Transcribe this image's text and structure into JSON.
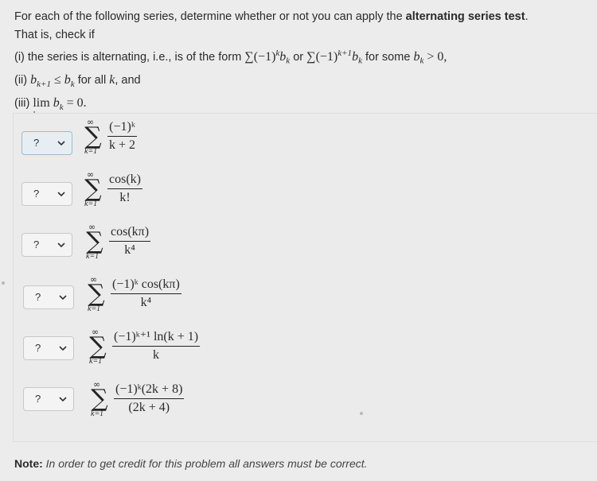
{
  "intro": {
    "line1_a": "For each of the following series, determine whether or not you can apply the",
    "line1_b": "alternating series test",
    "line1_c": ".",
    "line2": "That is, check if",
    "cond1_a": "(i) the series is alternating, i.e., is of the form",
    "cond1_f1": "∑(−1)",
    "cond1_e1": "k",
    "cond1_b1": "b",
    "cond1_s1": "k",
    "cond1_or": "or",
    "cond1_f2": "∑(−1)",
    "cond1_e2": "k+1",
    "cond1_b2": "b",
    "cond1_s2": "k",
    "cond1_c": "for some",
    "cond1_d": "b",
    "cond1_d_sub": "k",
    "cond1_gt": "> 0,",
    "cond2_a": "(ii)",
    "cond2_m": "b",
    "cond2_m_sub": "k+1",
    "cond2_le": "≤",
    "cond2_m2": "b",
    "cond2_m2_sub": "k",
    "cond2_b": "for all",
    "cond2_k": "k",
    "cond2_c": ", and",
    "cond3_a": "(iii)",
    "cond3_lim": "lim",
    "cond3_lim_sub": "k→∞",
    "cond3_m": "b",
    "cond3_m_sub": "k",
    "cond3_eq": "= 0."
  },
  "rows": [
    {
      "select_value": "?",
      "upper": "∞",
      "lower": "k=1",
      "numerator": "(−1)ᵏ",
      "denominator": "k + 2"
    },
    {
      "select_value": "?",
      "upper": "∞",
      "lower": "k=1",
      "numerator": "cos(k)",
      "denominator": "k!"
    },
    {
      "select_value": "?",
      "upper": "∞",
      "lower": "k=1",
      "numerator": "cos(kπ)",
      "denominator": "k⁴"
    },
    {
      "select_value": "?",
      "upper": "∞",
      "lower": "k=1",
      "numerator": "(−1)ᵏ cos(kπ)",
      "denominator": "k⁴"
    },
    {
      "select_value": "?",
      "upper": "∞",
      "lower": "k=1",
      "numerator": "(−1)ᵏ⁺¹ ln(k + 1)",
      "denominator": "k"
    },
    {
      "select_value": "?",
      "upper": "∞",
      "lower": "k=1",
      "numerator": "(−1)ᵏ(2k + 8)",
      "denominator": "(2k + 4)"
    }
  ],
  "note": {
    "label": "Note:",
    "text": "In order to get credit for this problem all answers must be correct."
  },
  "icons": {
    "dropdown": "chevron-down-icon",
    "sum": "sigma-symbol"
  }
}
